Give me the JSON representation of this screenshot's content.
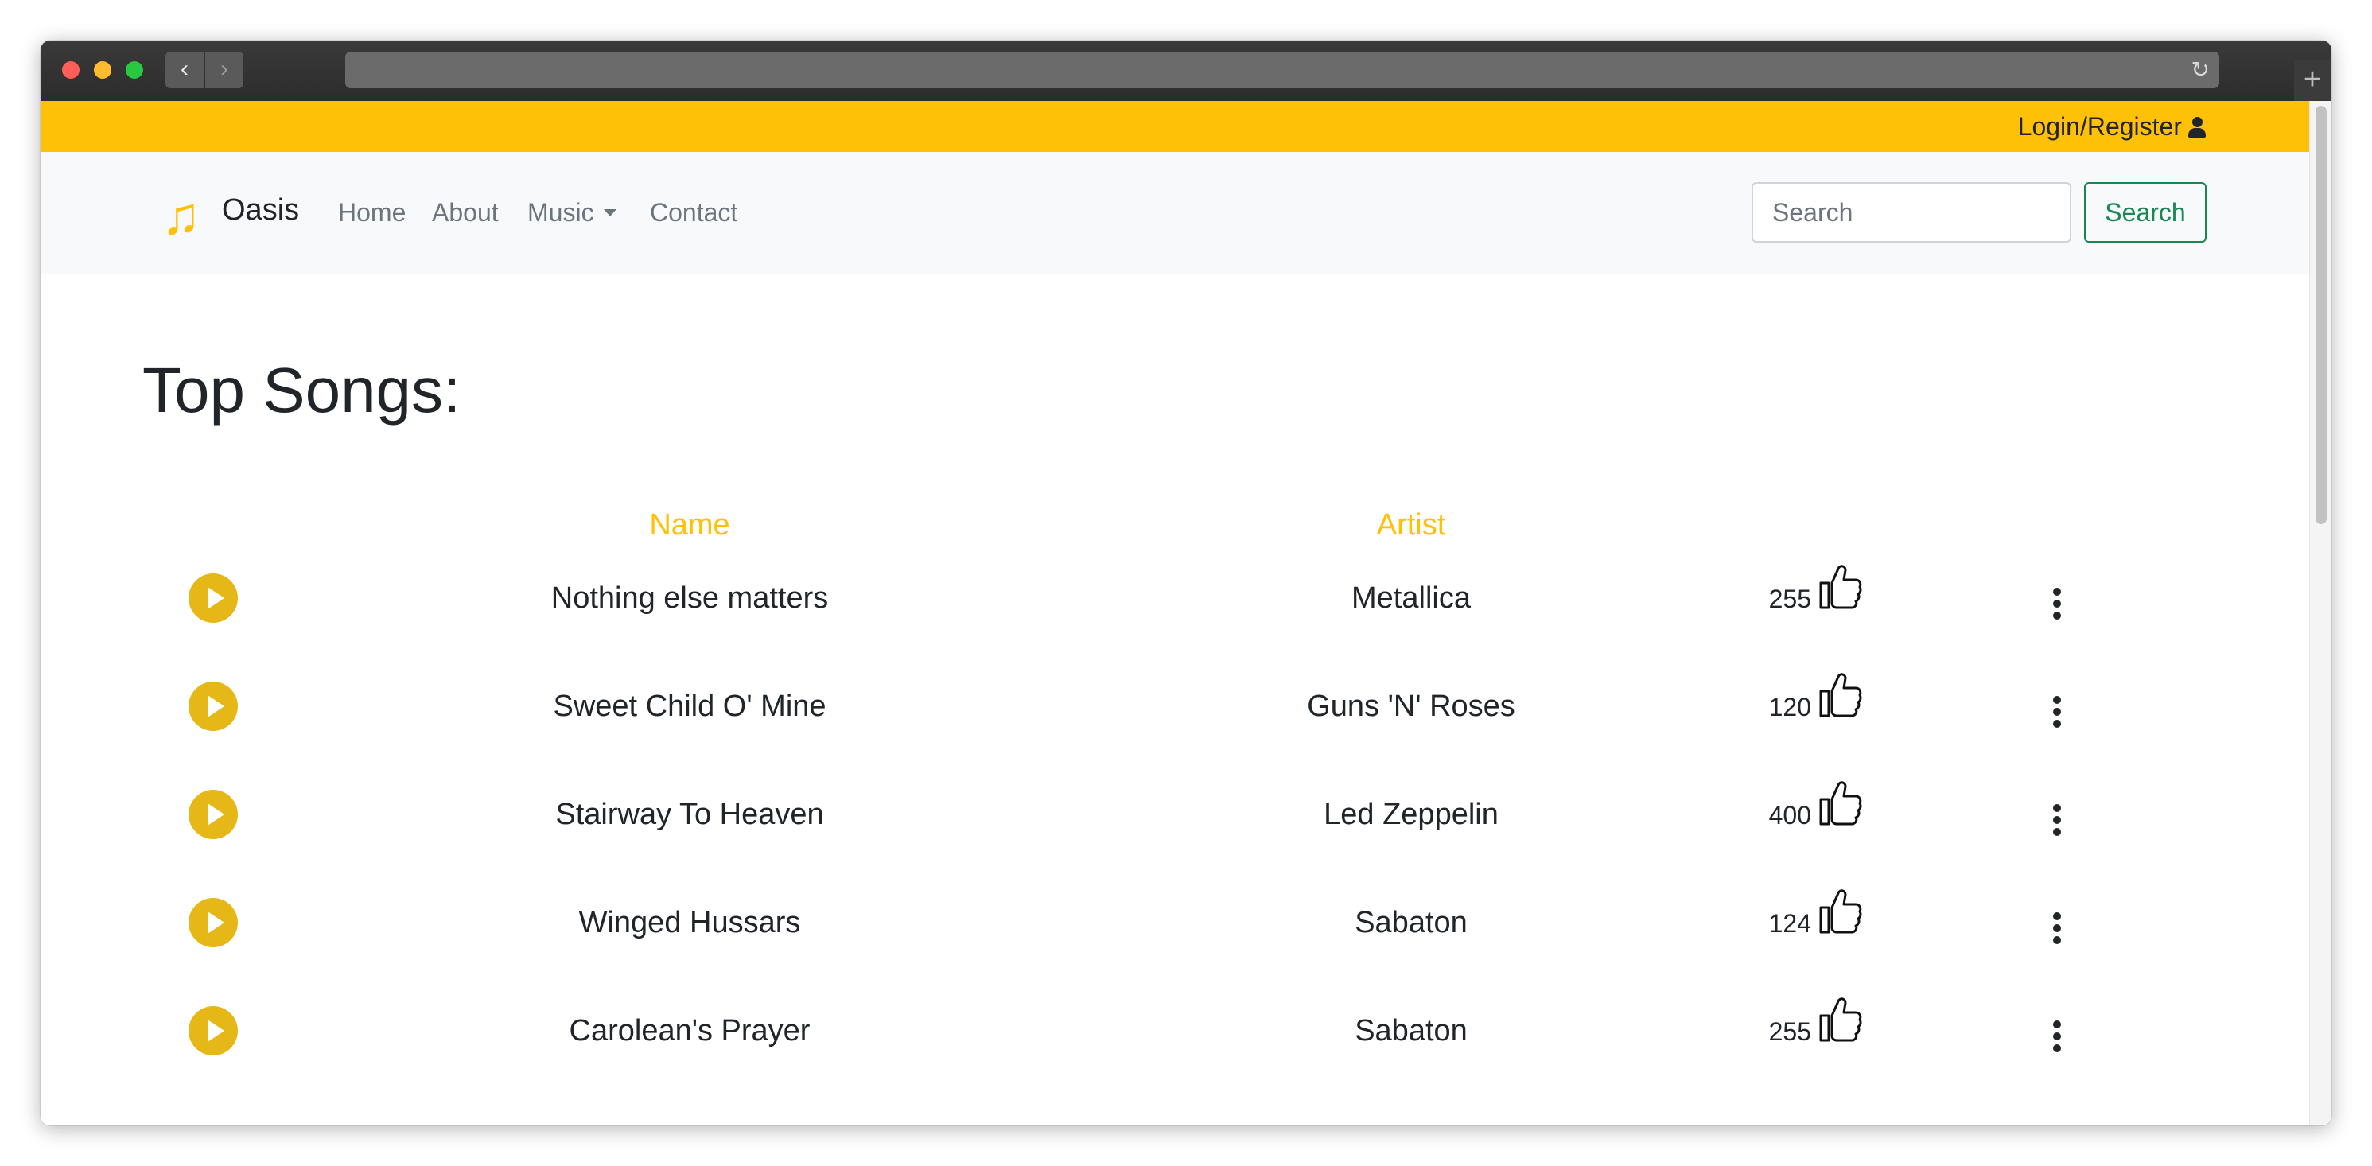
{
  "header": {
    "login_label": "Login/Register",
    "user_icon": "user-icon"
  },
  "navbar": {
    "brand": "Oasis",
    "brand_icon": "music-note-icon",
    "links": [
      "Home",
      "About",
      "Music",
      "Contact"
    ],
    "search_placeholder": "Search",
    "search_button": "Search"
  },
  "main": {
    "title": "Top Songs:",
    "columns": [
      "Name",
      "Artist"
    ],
    "songs": [
      {
        "name": "Nothing else matters",
        "artist": "Metallica",
        "likes": "255"
      },
      {
        "name": "Sweet Child O' Mine",
        "artist": "Guns 'N' Roses",
        "likes": "120"
      },
      {
        "name": "Stairway To Heaven",
        "artist": "Led Zeppelin",
        "likes": "400"
      },
      {
        "name": "Winged Hussars",
        "artist": "Sabaton",
        "likes": "124"
      },
      {
        "name": "Carolean's Prayer",
        "artist": "Sabaton",
        "likes": "255"
      }
    ]
  },
  "colors": {
    "accent": "#ffc107",
    "play": "#e6b817",
    "search_green": "#198754"
  }
}
